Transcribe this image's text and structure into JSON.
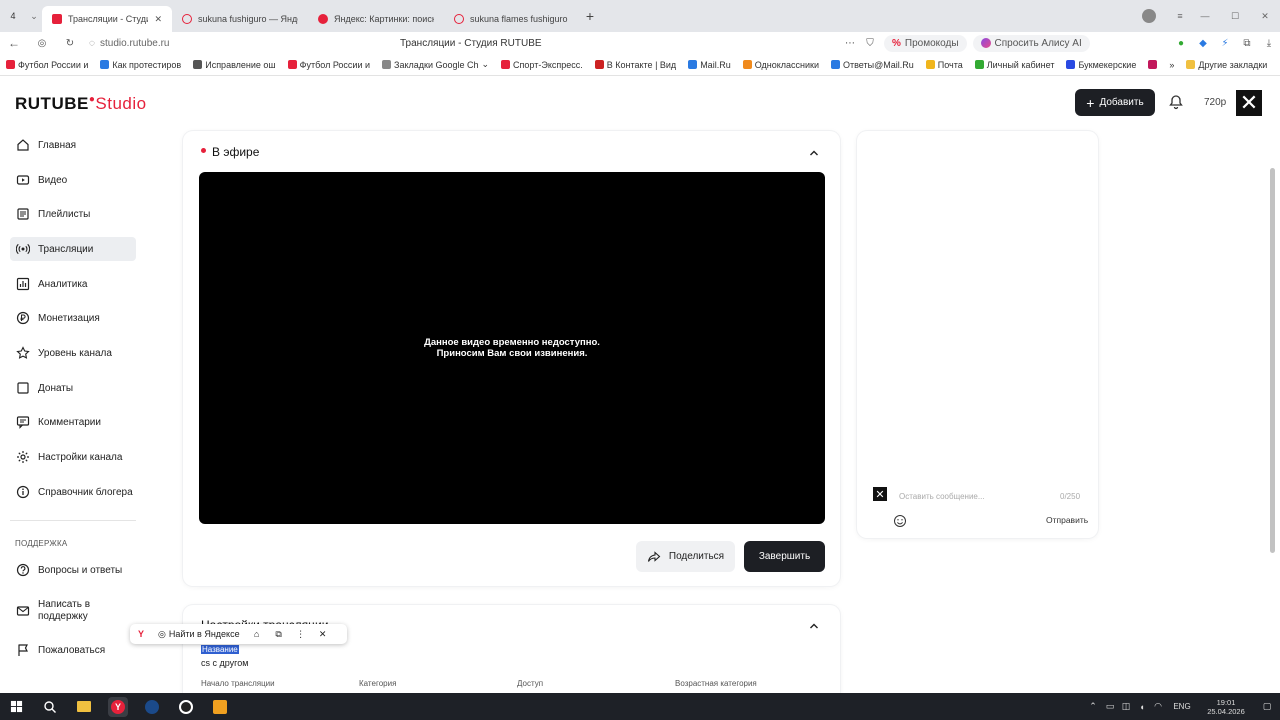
{
  "browser": {
    "tab_count": "4",
    "tabs": [
      {
        "title": "Трансляции - Студия R",
        "color": "#e6213b"
      },
      {
        "title": "sukuna fushiguro — Яндекс",
        "color": "#e6213b"
      },
      {
        "title": "Яндекс: Картинки: поиск",
        "color": "#e6213b"
      },
      {
        "title": "sukuna flames fushiguro -",
        "color": "#e6213b"
      }
    ],
    "address": "studio.rutube.ru",
    "page_title": "Трансляции - Студия RUTUBE",
    "promo_label": "Промокоды",
    "alisa_label": "Спросить Алису AI",
    "bookmarks": [
      {
        "label": "Футбол России и",
        "color": "#e6213b"
      },
      {
        "label": "Как протестиров",
        "color": "#2a7ae2"
      },
      {
        "label": "Исправление ош",
        "color": "#555"
      },
      {
        "label": "Футбол России и",
        "color": "#e6213b"
      },
      {
        "label": "Закладки Google Ch",
        "color": "#888"
      },
      {
        "label": "Спорт-Экспресс.",
        "color": "#e6213b"
      },
      {
        "label": "В Контакте | Вид",
        "color": "#c22"
      },
      {
        "label": "Mail.Ru",
        "color": "#2a7ae2"
      },
      {
        "label": "Одноклассники",
        "color": "#f08a1c"
      },
      {
        "label": "Ответы@Mail.Ru",
        "color": "#2a7ae2"
      },
      {
        "label": "Почта",
        "color": "#f0b51c"
      },
      {
        "label": "Личный кабинет",
        "color": "#3a3"
      },
      {
        "label": "Букмекерские",
        "color": "#2a4ae2"
      }
    ],
    "other_bookmarks": "Другие закладки"
  },
  "app": {
    "logo_main": "RUTUBE",
    "logo_studio": "Studio",
    "add_button": "Добавить",
    "quality": "720p"
  },
  "sidebar": {
    "items": [
      {
        "label": "Главная",
        "icon": "home-icon"
      },
      {
        "label": "Видео",
        "icon": "video-icon"
      },
      {
        "label": "Плейлисты",
        "icon": "playlist-icon"
      },
      {
        "label": "Трансляции",
        "icon": "broadcast-icon"
      },
      {
        "label": "Аналитика",
        "icon": "analytics-icon"
      },
      {
        "label": "Монетизация",
        "icon": "ruble-icon"
      },
      {
        "label": "Уровень канала",
        "icon": "star-icon"
      },
      {
        "label": "Донаты",
        "icon": "donate-icon"
      },
      {
        "label": "Комментарии",
        "icon": "comments-icon"
      },
      {
        "label": "Настройки канала",
        "icon": "gear-icon"
      },
      {
        "label": "Справочник блогера",
        "icon": "info-icon"
      }
    ],
    "support_heading": "ПОДДЕРЖКА",
    "support_items": [
      {
        "label": "Вопросы и ответы",
        "icon": "question-icon"
      },
      {
        "label": "Написать в поддержку",
        "icon": "mail-icon"
      },
      {
        "label": "Пожаловаться",
        "icon": "flag-icon"
      }
    ]
  },
  "live": {
    "heading": "В эфире",
    "error_line1": "Данное видео временно недоступно.",
    "error_line2": "Приносим Вам свои извинения.",
    "share_button": "Поделиться",
    "finish_button": "Завершить"
  },
  "chat": {
    "placeholder": "Оставить сообщение...",
    "counter": "0/250",
    "send_label": "Отправить"
  },
  "settings": {
    "heading": "Настройки трансляции",
    "name_label": "Название",
    "name_value": "cs с другом",
    "fields": [
      "Начало трансляции",
      "Категория",
      "Доступ",
      "Возрастная категория"
    ]
  },
  "popup": {
    "search_label": "Найти в Яндексе"
  },
  "taskbar": {
    "lang": "ENG",
    "time": "19:01",
    "date": "25.04.2026"
  }
}
